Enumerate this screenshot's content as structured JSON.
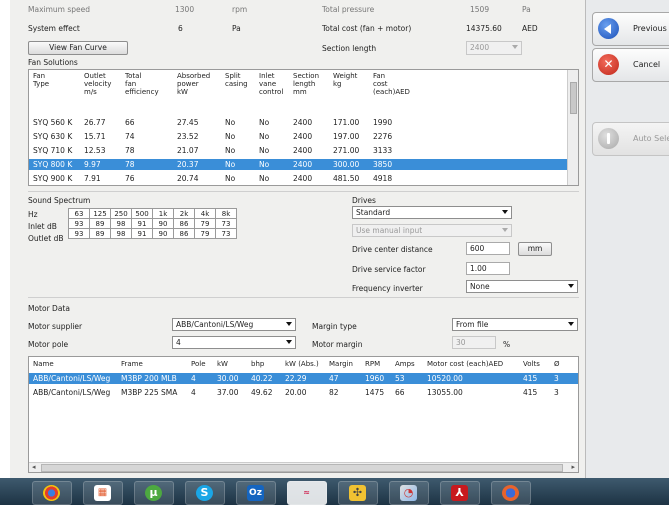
{
  "top": {
    "max_speed_label": "Maximum speed",
    "max_speed_value": "1300",
    "max_speed_unit": "rpm",
    "total_pressure_label": "Total pressure",
    "total_pressure_value": "1509",
    "total_pressure_unit": "Pa",
    "system_effect_label": "System effect",
    "system_effect_value": "6",
    "system_effect_unit": "Pa",
    "total_cost_label": "Total cost (fan + motor)",
    "total_cost_value": "14375.60",
    "total_cost_unit": "AED",
    "view_fan_curve": "View Fan Curve",
    "section_length_label": "Section length",
    "section_length_value": "2400"
  },
  "fan_solutions": {
    "title": "Fan Solutions",
    "headers": [
      "Fan\nType",
      "Outlet\nvelocity\nm/s",
      "Total\nfan\nefficiency",
      "Absorbed\npower\nkW",
      "Split\ncasing",
      "Inlet\nvane\ncontrol",
      "Section\nlength\nmm",
      "Weight\nkg",
      "Fan\ncost\n(each)AED"
    ],
    "rows": [
      [
        "SYQ 560 K",
        "26.77",
        "66",
        "27.45",
        "No",
        "No",
        "2400",
        "171.00",
        "1990"
      ],
      [
        "SYQ 630 K",
        "15.71",
        "74",
        "23.52",
        "No",
        "No",
        "2400",
        "197.00",
        "2276"
      ],
      [
        "SYQ 710 K",
        "12.53",
        "78",
        "21.07",
        "No",
        "No",
        "2400",
        "271.00",
        "3133"
      ],
      [
        "SYQ 800 K",
        "9.97",
        "78",
        "20.37",
        "No",
        "No",
        "2400",
        "300.00",
        "3850"
      ],
      [
        "SYQ 900 K",
        "7.91",
        "76",
        "20.74",
        "No",
        "No",
        "2400",
        "481.50",
        "4918"
      ]
    ]
  },
  "sound": {
    "title": "Sound Spectrum",
    "hz_label": "Hz",
    "inlet_label": "Inlet dB",
    "outlet_label": "Outlet dB",
    "hz": [
      "63",
      "125",
      "250",
      "500",
      "1k",
      "2k",
      "4k",
      "8k"
    ],
    "inlet": [
      "93",
      "89",
      "98",
      "91",
      "90",
      "86",
      "79",
      "73"
    ],
    "outlet": [
      "93",
      "89",
      "98",
      "91",
      "90",
      "86",
      "79",
      "73"
    ]
  },
  "drives": {
    "title": "Drives",
    "drive_type": "Standard",
    "manual_input": "Use manual input",
    "center_distance_label": "Drive center distance",
    "center_distance_value": "600",
    "center_distance_unit": "mm",
    "service_factor_label": "Drive service factor",
    "service_factor_value": "1.00",
    "freq_inverter_label": "Frequency inverter",
    "freq_inverter_value": "None"
  },
  "motor": {
    "title": "Motor Data",
    "supplier_label": "Motor supplier",
    "supplier_value": "ABB/Cantoni/LS/Weg",
    "poles_label": "Motor pole",
    "poles_value": "4",
    "margin_type_label": "Margin type",
    "margin_type_value": "From file",
    "margin_label": "Motor margin",
    "margin_value": "30",
    "margin_unit": "%",
    "headers": [
      "Name",
      "Frame",
      "Pole",
      "kW",
      "bhp",
      "kW (Abs.)",
      "Margin",
      "RPM",
      "Amps",
      "Motor cost (each)AED",
      "Volts",
      "Ø"
    ],
    "rows": [
      [
        "ABB/Cantoni/LS/Weg",
        "M3BP 200 MLB",
        "4",
        "30.00",
        "40.22",
        "22.29",
        "47",
        "1960",
        "53",
        "10520.00",
        "415",
        "3"
      ],
      [
        "ABB/Cantoni/LS/Weg",
        "M3BP 225 SMA",
        "4",
        "37.00",
        "49.62",
        "20.00",
        "82",
        "1475",
        "66",
        "13055.00",
        "415",
        "3"
      ]
    ]
  },
  "side_buttons": {
    "previous": "Previous",
    "cancel": "Cancel",
    "auto_select": "Auto Select"
  },
  "taskbar": [
    "chrome-icon",
    "windows-grid-icon",
    "utorrent-icon",
    "skype-icon",
    "outlook-icon",
    "app-icon",
    "network-icon",
    "paint-icon",
    "acrobat-icon",
    "firefox-icon"
  ]
}
